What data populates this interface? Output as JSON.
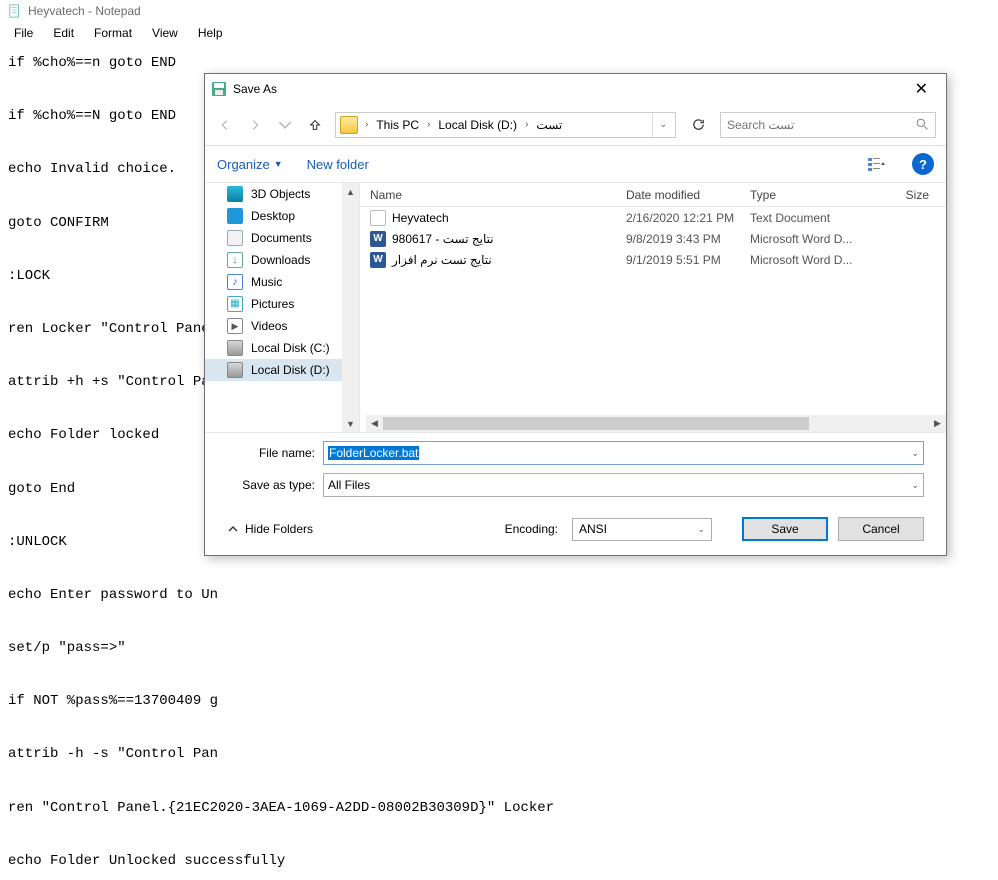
{
  "notepad": {
    "title": "Heyvatech - Notepad",
    "menu": [
      "File",
      "Edit",
      "Format",
      "View",
      "Help"
    ],
    "content": "if %cho%==n goto END\n\nif %cho%==N goto END\n\necho Invalid choice.\n\ngoto CONFIRM\n\n:LOCK\n\nren Locker \"Control Panel\n\nattrib +h +s \"Control Pane\n\necho Folder locked\n\ngoto End\n\n:UNLOCK\n\necho Enter password to Un\n\nset/p \"pass=>\"\n\nif NOT %pass%==13700409 g\n\nattrib -h -s \"Control Pan\n\nren \"Control Panel.{21EC2020-3AEA-1069-A2DD-08002B30309D}\" Locker\n\necho Folder Unlocked successfully"
  },
  "dialog": {
    "title": "Save As",
    "breadcrumb": {
      "seg1": "This PC",
      "seg2": "Local Disk (D:)",
      "seg3": "تست"
    },
    "search_placeholder": "Search تست",
    "organize": "Organize",
    "new_folder": "New folder",
    "sidebar": [
      {
        "label": "3D Objects",
        "icon": "c-3d"
      },
      {
        "label": "Desktop",
        "icon": "c-desk"
      },
      {
        "label": "Documents",
        "icon": "c-docs"
      },
      {
        "label": "Downloads",
        "icon": "c-dl"
      },
      {
        "label": "Music",
        "icon": "c-music"
      },
      {
        "label": "Pictures",
        "icon": "c-pic"
      },
      {
        "label": "Videos",
        "icon": "c-vid"
      },
      {
        "label": "Local Disk (C:)",
        "icon": "c-disk"
      },
      {
        "label": "Local Disk (D:)",
        "icon": "c-disk",
        "selected": true
      }
    ],
    "columns": {
      "name": "Name",
      "date": "Date modified",
      "type": "Type",
      "size": "Size"
    },
    "files": [
      {
        "name": "Heyvatech",
        "date": "2/16/2020 12:21 PM",
        "type": "Text Document",
        "icon": "c-txt"
      },
      {
        "name": "نتایج تست - 980617",
        "date": "9/8/2019 3:43 PM",
        "type": "Microsoft Word D...",
        "icon": "c-word"
      },
      {
        "name": "نتایج تست نرم افزار",
        "date": "9/1/2019 5:51 PM",
        "type": "Microsoft Word D...",
        "icon": "c-word"
      }
    ],
    "filename_label": "File name:",
    "filename_value": "FolderLocker.bat",
    "savetype_label": "Save as type:",
    "savetype_value": "All Files",
    "hide_folders": "Hide Folders",
    "encoding_label": "Encoding:",
    "encoding_value": "ANSI",
    "save": "Save",
    "cancel": "Cancel"
  }
}
